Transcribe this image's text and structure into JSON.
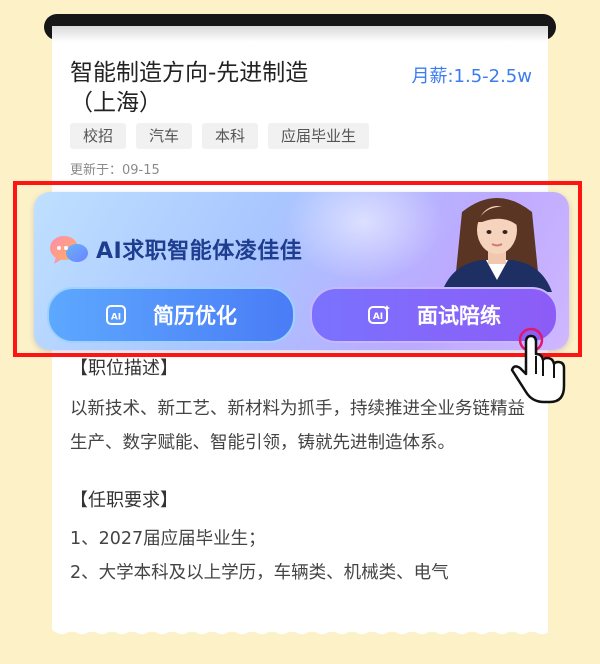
{
  "job": {
    "title_line1": "智能制造方向-先进制造",
    "title_line2": "（上海）",
    "salary": "月薪:1.5-2.5w",
    "tags": [
      "校招",
      "汽车",
      "本科",
      "应届毕业生"
    ],
    "updated": "更新于：09-15"
  },
  "ai_card": {
    "title": "AI求职智能体凌佳佳",
    "resume_button": "简历优化",
    "interview_button": "面试陪练",
    "button_icon_text": "AI"
  },
  "description": {
    "heading": "【职位描述】",
    "text": "以新技术、新工艺、新材料为抓手，持续推进全业务链精益生产、数字赋能、智能引领，铸就先进制造体系。"
  },
  "requirements": {
    "heading": "【任职要求】",
    "items": [
      "1、2027届应届毕业生；",
      "2、大学本科及以上学历，车辆类、机械类、电气"
    ]
  },
  "colors": {
    "accent_blue": "#3b7cf0",
    "highlight_red": "#ff1414",
    "background": "#fdf1c7"
  }
}
